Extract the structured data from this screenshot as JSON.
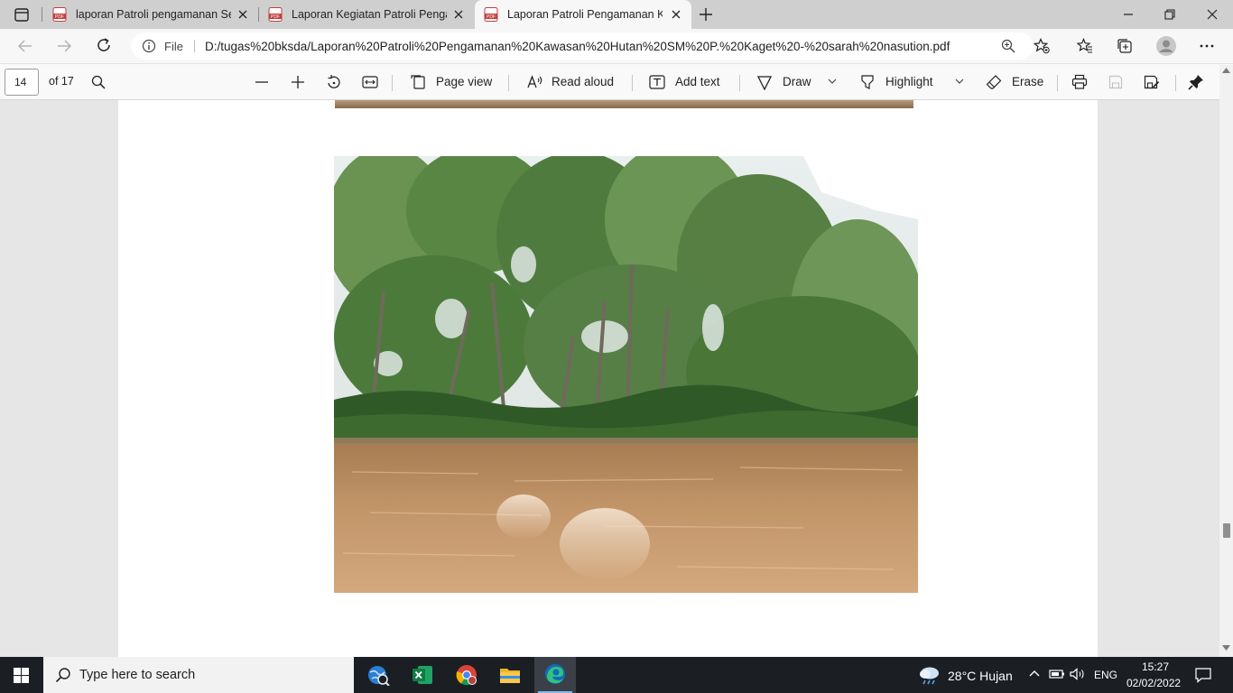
{
  "browser": {
    "tabs": [
      {
        "title": "laporan Patroli pengamanan Seb",
        "active": false
      },
      {
        "title": "Laporan Kegiatan Patroli Pengam",
        "active": false
      },
      {
        "title": "Laporan Patroli Pengamanan Kav",
        "active": true
      }
    ],
    "address": {
      "scheme_label": "File",
      "url": "D:/tugas%20bksda/Laporan%20Patroli%20Pengamanan%20Kawasan%20Hutan%20SM%20P.%20Kaget%20-%20sarah%20nasution.pdf"
    }
  },
  "pdf_toolbar": {
    "page_number": "14",
    "page_total": "of 17",
    "page_view": "Page view",
    "read_aloud": "Read aloud",
    "add_text": "Add text",
    "draw": "Draw",
    "highlight": "Highlight",
    "erase": "Erase"
  },
  "document": {
    "image_description": "river with mangrove forest bank"
  },
  "taskbar": {
    "search_placeholder": "Type here to search",
    "weather": "28°C  Hujan",
    "language": "ENG",
    "time": "15:27",
    "date": "02/02/2022"
  },
  "colors": {
    "accent_edge": "#0f6cbd",
    "pdf_red": "#c43e3e",
    "excel_green": "#107c41"
  }
}
